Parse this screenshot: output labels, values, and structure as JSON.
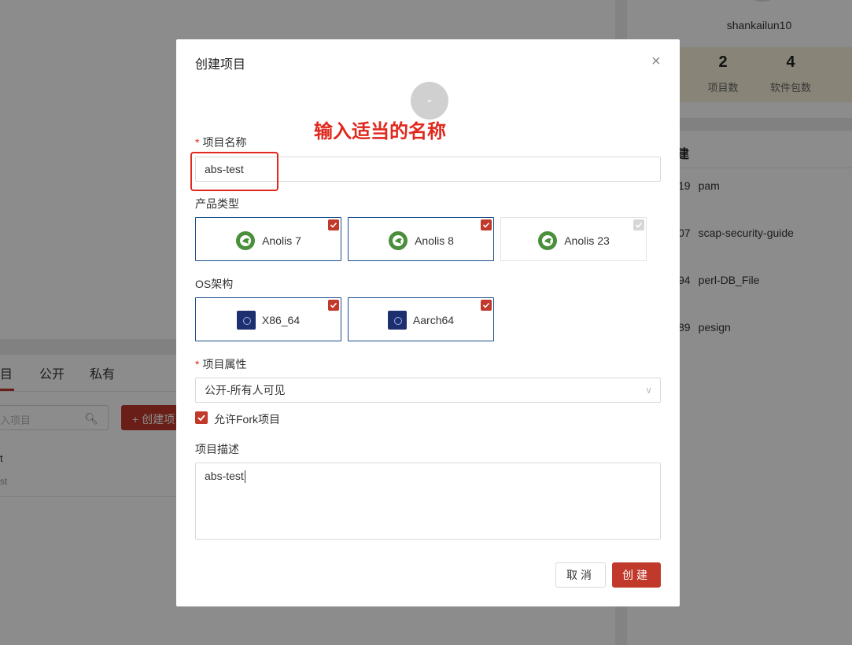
{
  "background": {
    "username": "shankailun10",
    "stats": [
      {
        "value": "2",
        "label": "项目数"
      },
      {
        "value": "4",
        "label": "软件包数"
      }
    ],
    "recent_heading": "建",
    "recent_packages": [
      {
        "num": "19",
        "name": "pam"
      },
      {
        "num": "07",
        "name": "scap-security-guide"
      },
      {
        "num": "94",
        "name": "perl-DB_File"
      },
      {
        "num": "89",
        "name": "pesign"
      }
    ],
    "tabs": [
      "目",
      "公开",
      "私有"
    ],
    "search_placeholder": "入项目",
    "create_button": "+ 创建项",
    "row_title": "t",
    "row_sub": "st"
  },
  "modal": {
    "title": "创建项目",
    "close_glyph": "×",
    "avatar_placeholder": "-",
    "annotation": "输入适当的名称",
    "name_label": "项目名称",
    "name_value": "abs-test",
    "product_type_label": "产品类型",
    "product_types": [
      {
        "label": "Anolis 7",
        "checked": true
      },
      {
        "label": "Anolis 8",
        "checked": true
      },
      {
        "label": "Anolis 23",
        "checked": false
      }
    ],
    "arch_label": "OS架构",
    "archs": [
      {
        "label": "X86_64",
        "checked": true
      },
      {
        "label": "Aarch64",
        "checked": true
      }
    ],
    "attr_label": "项目属性",
    "attr_value": "公开-所有人可见",
    "fork_label": "允许Fork项目",
    "fork_checked": true,
    "desc_label": "项目描述",
    "desc_value": "abs-test",
    "cancel_label": "取消",
    "create_label": "创建"
  },
  "colors": {
    "accent": "#c0392b",
    "annotation": "#e0281d",
    "selected_border": "#1a4f8a",
    "anolis_green": "#4a8f3c"
  }
}
